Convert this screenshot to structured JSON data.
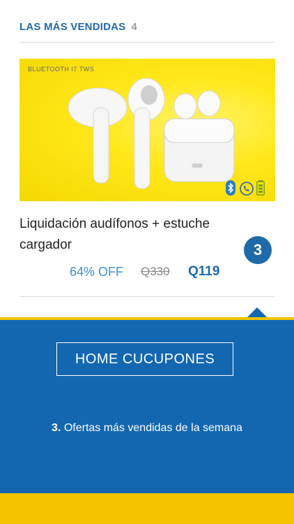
{
  "section": {
    "title": "LAS MÁS VENDIDAS",
    "count": "4"
  },
  "product": {
    "image_caption": "BLUETOOTH I7 TWS",
    "title": "Liquidación audífonos + estuche cargador",
    "discount": "64% OFF",
    "old_price": "Q330",
    "new_price": "Q119"
  },
  "step_badge": "3",
  "tooltip": {
    "button_label": "HOME CUCUPONES",
    "caption_number": "3.",
    "caption_text": " Ofertas más vendidas de la semana"
  },
  "colors": {
    "brand_blue": "#1367b1",
    "accent_yellow": "#f4c400",
    "price_blue": "#1f6aa8",
    "discount_blue": "#3b8fcf"
  }
}
